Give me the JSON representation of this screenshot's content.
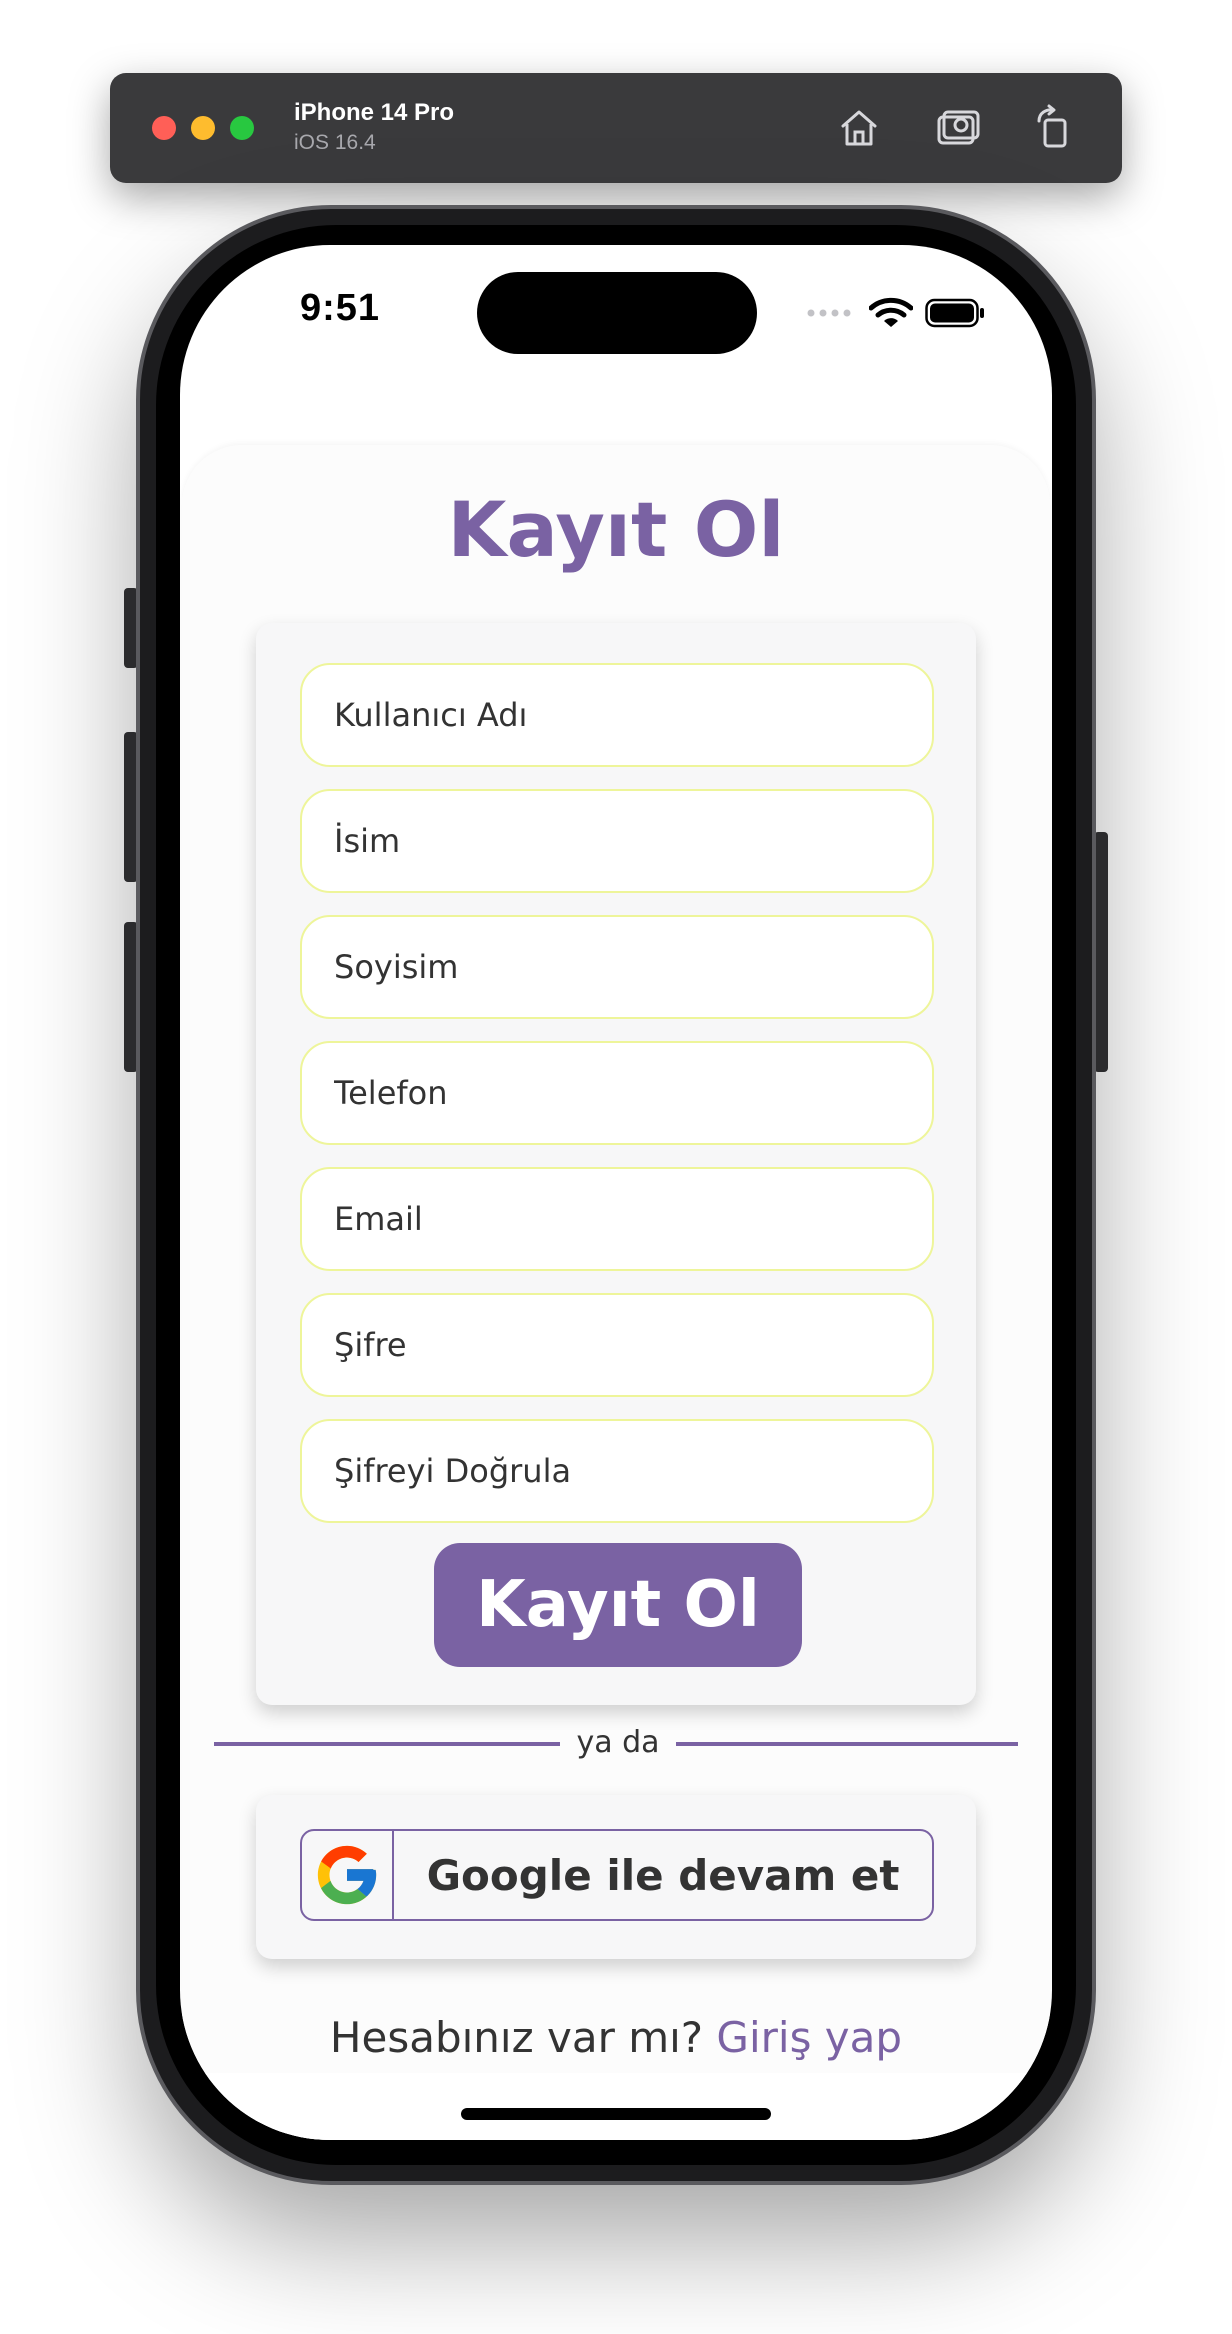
{
  "simulator": {
    "device_name": "iPhone 14 Pro",
    "os_version": "iOS 16.4",
    "icons": [
      "home-icon",
      "screenshot-icon",
      "rotate-icon"
    ]
  },
  "status_bar": {
    "time": "9:51",
    "icons": [
      "signal-icon",
      "wifi-icon",
      "battery-icon"
    ]
  },
  "page": {
    "title": "Kayıt Ol"
  },
  "form": {
    "fields": [
      {
        "placeholder": "Kullanıcı Adı",
        "value": ""
      },
      {
        "placeholder": "İsim",
        "value": ""
      },
      {
        "placeholder": "Soyisim",
        "value": ""
      },
      {
        "placeholder": "Telefon",
        "value": ""
      },
      {
        "placeholder": "Email",
        "value": ""
      },
      {
        "placeholder": "Şifre",
        "value": ""
      },
      {
        "placeholder": "Şifreyi Doğrula",
        "value": ""
      }
    ],
    "submit_label": "Kayıt Ol"
  },
  "divider": {
    "label": "ya da"
  },
  "google": {
    "label": "Google ile devam et",
    "icon": "google-icon"
  },
  "footer": {
    "question": "Hesabınız var mı?",
    "link_label": "Giriş yap"
  },
  "colors": {
    "accent": "#7a62a3",
    "field_border": "#eef59a",
    "card_background": "#f7f7f8",
    "text": "#333333"
  }
}
